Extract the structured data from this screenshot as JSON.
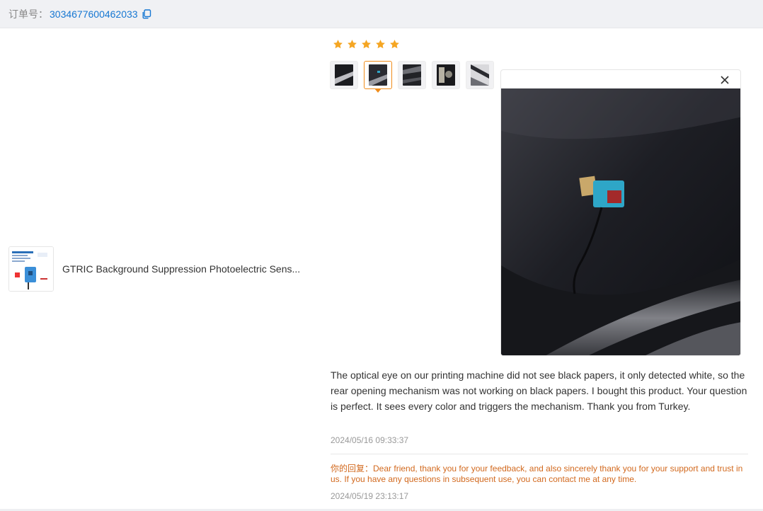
{
  "order": {
    "label": "订单号：",
    "number": "3034677600462033"
  },
  "product": {
    "title": "GTRIC Background Suppression Photoelectric Sens...",
    "thumb_text": "GT-H42BG"
  },
  "review": {
    "rating": 5,
    "rating_max": 5,
    "star_color": "#f5a623",
    "active_thumb_index": 1,
    "thumbs": [
      {
        "name": "review-photo-1"
      },
      {
        "name": "review-photo-2"
      },
      {
        "name": "review-photo-3"
      },
      {
        "name": "review-photo-4"
      },
      {
        "name": "review-photo-5"
      }
    ],
    "text": "The optical eye on our printing machine did not see black papers, it only detected white, so the rear opening mechanism was not working on black papers. I bought this product. Your question is perfect. It sees every color and triggers the mechanism. Thank you from Turkey.",
    "date": "2024/05/16 09:33:37"
  },
  "reply": {
    "label": "你的回复：",
    "text": "Dear friend, thank you for your feedback, and also sincerely thank you for your support and trust in us. If you have any questions in subsequent use, you can contact me at any time.",
    "date": "2024/05/19 23:13:17"
  },
  "colors": {
    "link": "#1677d2",
    "accent": "#f08c1a",
    "reply": "#d2691e"
  }
}
